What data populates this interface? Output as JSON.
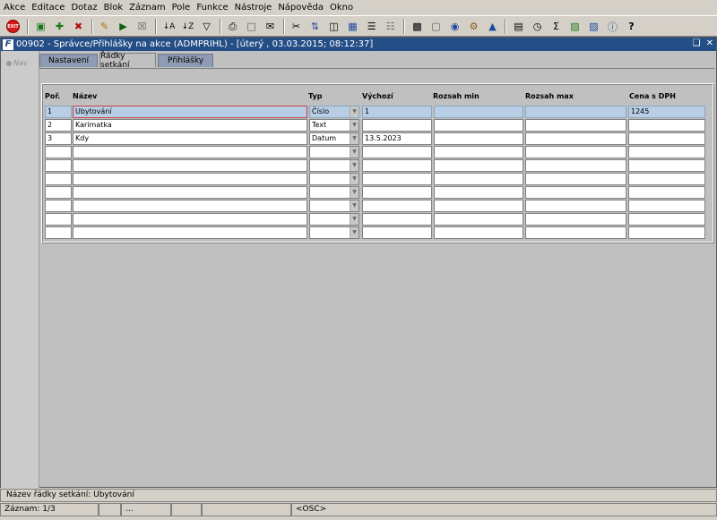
{
  "menubar": {
    "items": [
      "Akce",
      "Editace",
      "Dotaz",
      "Blok",
      "Záznam",
      "Pole",
      "Funkce",
      "Nástroje",
      "Nápověda",
      "Okno"
    ]
  },
  "toolbar": {
    "exit_label": "EXIT",
    "icons": [
      "save-icon",
      "insert-record-icon",
      "delete-record-icon",
      "enter-query-icon",
      "execute-query-icon",
      "cancel-query-icon",
      "sort-ascending-icon",
      "sort-descending-icon",
      "filter-icon",
      "print-icon",
      "print-preview-icon",
      "email-icon",
      "cut-icon",
      "copy-icon",
      "paste-icon",
      "list-icon",
      "block-icon",
      "export-icon",
      "document-icon",
      "globe-icon",
      "settings-icon",
      "alert-icon",
      "chart-icon",
      "clock-icon",
      "sum-icon",
      "excel-icon",
      "word-icon",
      "info-icon",
      "help-icon"
    ]
  },
  "window": {
    "title": "00902 - Správce/Přihlášky na akce (ADMPRIHL) - [úterý  , 03.03.2015; 08:12:37]",
    "logo": "F",
    "nav_label": "Nav"
  },
  "tabs": [
    {
      "label": "Nastavení"
    },
    {
      "label": "Řádky setkání"
    },
    {
      "label": "Přihlášky"
    }
  ],
  "table": {
    "headers": {
      "por": "Poř.",
      "nazev": "Název",
      "typ": "Typ",
      "vychozi": "Výchozí",
      "rozsah_min": "Rozsah min",
      "rozsah_max": "Rozsah max",
      "cena": "Cena s DPH"
    },
    "rows": [
      {
        "por": "1",
        "nazev": "Ubytování",
        "typ": "Číslo",
        "vychozi": "1",
        "rozsah_min": "",
        "rozsah_max": "",
        "cena": "1245"
      },
      {
        "por": "2",
        "nazev": "Karimatka",
        "typ": "Text",
        "vychozi": "",
        "rozsah_min": "",
        "rozsah_max": "",
        "cena": ""
      },
      {
        "por": "3",
        "nazev": "Kdy",
        "typ": "Datum",
        "vychozi": "13.5.2023",
        "rozsah_min": "",
        "rozsah_max": "",
        "cena": ""
      },
      {
        "por": "",
        "nazev": "",
        "typ": "",
        "vychozi": "",
        "rozsah_min": "",
        "rozsah_max": "",
        "cena": ""
      },
      {
        "por": "",
        "nazev": "",
        "typ": "",
        "vychozi": "",
        "rozsah_min": "",
        "rozsah_max": "",
        "cena": ""
      },
      {
        "por": "",
        "nazev": "",
        "typ": "",
        "vychozi": "",
        "rozsah_min": "",
        "rozsah_max": "",
        "cena": ""
      },
      {
        "por": "",
        "nazev": "",
        "typ": "",
        "vychozi": "",
        "rozsah_min": "",
        "rozsah_max": "",
        "cena": ""
      },
      {
        "por": "",
        "nazev": "",
        "typ": "",
        "vychozi": "",
        "rozsah_min": "",
        "rozsah_max": "",
        "cena": ""
      },
      {
        "por": "",
        "nazev": "",
        "typ": "",
        "vychozi": "",
        "rozsah_min": "",
        "rozsah_max": "",
        "cena": ""
      },
      {
        "por": "",
        "nazev": "",
        "typ": "",
        "vychozi": "",
        "rozsah_min": "",
        "rozsah_max": "",
        "cena": ""
      }
    ]
  },
  "status": {
    "hint": "Název řádky setkání: Ubytování",
    "record": "Záznam: 1/3",
    "ellipsis": "...",
    "mode": "<OSC>"
  }
}
